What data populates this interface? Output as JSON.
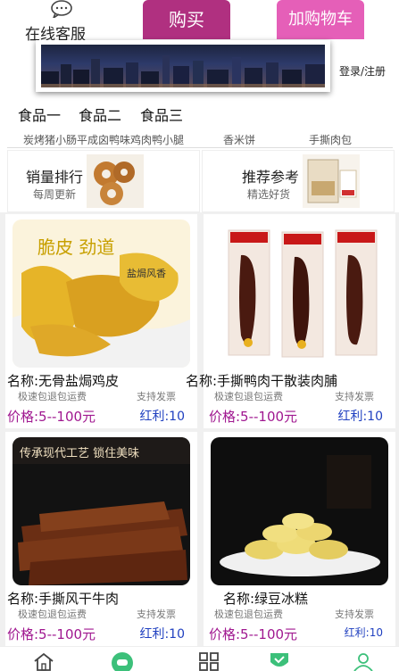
{
  "header": {
    "customer_service_label": "在线客服",
    "buy_label": "购买",
    "cart_label": "加购物车"
  },
  "banner": {
    "login_label": "登录/注册"
  },
  "tabs": [
    "食品一",
    "食品二",
    "食品三"
  ],
  "cutoff_row": [
    "炭烤猪小肠平成囟鸭味鸡肉鸭小腿",
    "香米饼",
    "手撕肉包"
  ],
  "promos": [
    {
      "title": "销量排行",
      "subtitle": "每周更新"
    },
    {
      "title": "推荐参考",
      "subtitle": "精选好货"
    }
  ],
  "products": [
    {
      "name": "名称:无骨盐焗鸡皮",
      "ship": "极速包退包运费",
      "support": "支持发票",
      "price": "价格:5--100元",
      "bonus": "红利:10",
      "image_text": "脆皮 劲道",
      "image_subtext": "盐焗风香"
    },
    {
      "name": "名称:手撕鸭肉干散装肉脯",
      "ship": "极速包退包运费",
      "support": "支持发票",
      "price": "价格:5--100元",
      "bonus": "红利:10"
    },
    {
      "name": "名称:手撕风干牛肉",
      "ship": "极速包退包运费",
      "support": "支持发票",
      "price": "价格:5--100元",
      "bonus": "红利:10",
      "image_text": "传承现代工艺 锁住美味"
    },
    {
      "name": "名称:绿豆冰糕",
      "ship": "极速包退包运费",
      "support": "支持发票",
      "price": "价格:5--100元",
      "bonus": "红利:10"
    }
  ],
  "nav": [
    "home-icon",
    "game-icon",
    "grid-icon",
    "heart-icon",
    "user-icon"
  ],
  "colors": {
    "buy": "#b03080",
    "cart": "#e55fb8",
    "price": "#a01890",
    "bonus": "#2040c0",
    "nav_green": "#3cc07a"
  }
}
